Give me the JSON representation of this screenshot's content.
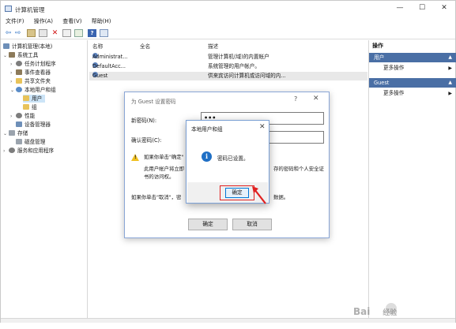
{
  "window": {
    "title": "计算机管理",
    "controls": {
      "minimize": "—",
      "maximize": "☐",
      "close": "✕"
    }
  },
  "menu": {
    "items": [
      "文件(F)",
      "操作(A)",
      "查看(V)",
      "帮助(H)"
    ]
  },
  "toolbar": {
    "back": "⇦",
    "forward": "⇨"
  },
  "tree": {
    "items": [
      {
        "label": "计算机管理(本地)"
      },
      {
        "label": "系统工具"
      },
      {
        "label": "任务计划程序"
      },
      {
        "label": "事件查看器"
      },
      {
        "label": "共享文件夹"
      },
      {
        "label": "本地用户和组"
      },
      {
        "label": "用户"
      },
      {
        "label": "组"
      },
      {
        "label": "性能"
      },
      {
        "label": "设备管理器"
      },
      {
        "label": "存储"
      },
      {
        "label": "磁盘管理"
      },
      {
        "label": "服务和应用程序"
      }
    ]
  },
  "list": {
    "columns": [
      "名称",
      "全名",
      "描述"
    ],
    "rows": [
      {
        "name": "Administrat...",
        "fullname": "",
        "desc": "管理计算机(域)的内置帐户"
      },
      {
        "name": "DefaultAcc...",
        "fullname": "",
        "desc": "系统管理的用户帐户。"
      },
      {
        "name": "Guest",
        "fullname": "",
        "desc": "供来宾访问计算机或访问域的内..."
      }
    ]
  },
  "actions": {
    "title": "操作",
    "sections": [
      {
        "label": "用户",
        "item": "更多操作"
      },
      {
        "label": "Guest",
        "item": "更多操作"
      }
    ]
  },
  "pwd_dialog": {
    "title": "为 Guest 设置密码",
    "help": "?",
    "close": "✕",
    "new_password_label": "新密码(N):",
    "new_password_value": "•••",
    "confirm_label": "确认密码(C):",
    "confirm_value": "",
    "warn_line1": "如果你单击\"确定\"",
    "warn_line2": "此用户帐户将立即",
    "warn_line2b": "存的密码和个人安全证",
    "warn_line3": "书的访问权。",
    "cancel_line": "如果你单击\"取消\"，密",
    "cancel_line_b": "数据。",
    "ok": "确定",
    "cancel": "取消"
  },
  "message_box": {
    "title": "本地用户和组",
    "close": "✕",
    "icon": "i",
    "text": "密码已设置。",
    "ok": "确定"
  },
  "watermark": {
    "text": "Bai",
    "suffix": "经验"
  },
  "colors": {
    "selection": "#cce4f7",
    "action_header": "#4a6fa5",
    "annotation_red": "#e02020",
    "info_blue": "#1f6fc5"
  }
}
